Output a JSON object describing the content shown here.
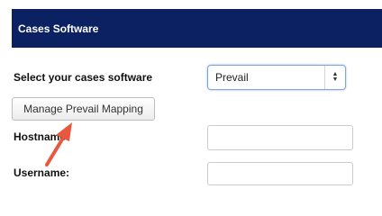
{
  "panel": {
    "title": "Cases Software"
  },
  "form": {
    "select_label": "Select your cases software",
    "selected_value": "Prevail",
    "manage_button_label": "Manage Prevail Mapping",
    "hostname_label": "Hostname:",
    "username_label": "Username:",
    "hostname_value": "",
    "username_value": ""
  },
  "colors": {
    "header_bg": "#0b2162",
    "annotation_arrow": "#e8583e"
  },
  "icons": {
    "select_caret": "up-down-caret-icon",
    "annotation": "red-arrow-icon"
  }
}
